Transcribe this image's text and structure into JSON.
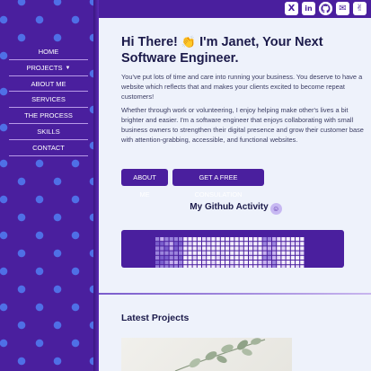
{
  "colors": {
    "brand": "#4a1f9e",
    "dot": "#4f6fe6",
    "text": "#1b1a4a",
    "background": "#eef2fb"
  },
  "social": [
    {
      "name": "x-icon",
      "glyph": "X"
    },
    {
      "name": "linkedin-icon",
      "glyph": "in"
    },
    {
      "name": "github-icon",
      "glyph": "●"
    },
    {
      "name": "email-icon",
      "glyph": "✉"
    },
    {
      "name": "peace-icon",
      "glyph": "✌"
    }
  ],
  "nav": {
    "items": [
      {
        "label": "HOME"
      },
      {
        "label": "PROJECTS",
        "dropdown": true
      },
      {
        "label": "ABOUT ME"
      },
      {
        "label": "SERVICES"
      },
      {
        "label": "THE PROCESS"
      },
      {
        "label": "SKILLS"
      },
      {
        "label": "CONTACT"
      }
    ]
  },
  "hero": {
    "title_before": "Hi There! ",
    "title_emoji": "👏",
    "title_after": " I'm Janet, Your Next Software Engineer.",
    "p1": "You've put lots of time and care into running your business. You deserve to have a website which reflects that and makes your clients excited to become repeat customers!",
    "p2": "Whether through work or volunteering, I enjoy helping make other's lives a bit brighter and easier. I'm a software engineer that enjoys collaborating with small business owners to strengthen their digital presence and grow their customer base with attention-grabbing, accessible, and functional websites.",
    "btn_about": "ABOUT ME",
    "btn_consult": "GET A FREE CONSULATION"
  },
  "github": {
    "title": "My Github Activity"
  },
  "latest": {
    "title": "Latest Projects"
  }
}
